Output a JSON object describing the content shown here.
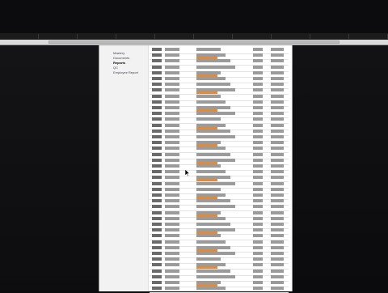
{
  "browser": {
    "tabs": [
      {
        "label": ""
      },
      {
        "label": ""
      },
      {
        "label": ""
      },
      {
        "label": ""
      },
      {
        "label": ""
      },
      {
        "label": ""
      },
      {
        "label": ""
      },
      {
        "label": ""
      },
      {
        "label": ""
      },
      {
        "label": ""
      }
    ]
  },
  "sidebar": {
    "items": [
      {
        "label": "Mastery",
        "active": false
      },
      {
        "label": "Documents",
        "active": false
      },
      {
        "label": "Reports",
        "active": true
      },
      {
        "label": "QC",
        "active": false
      },
      {
        "label": "Employee Report",
        "active": false
      }
    ]
  },
  "table": {
    "rows": []
  },
  "colors": {
    "accent_orange": "#e08a3c",
    "page_bg": "#ffffff",
    "desktop_bg": "#0c0c0e"
  },
  "icons": {
    "cursor": "arrow-cursor-icon"
  }
}
